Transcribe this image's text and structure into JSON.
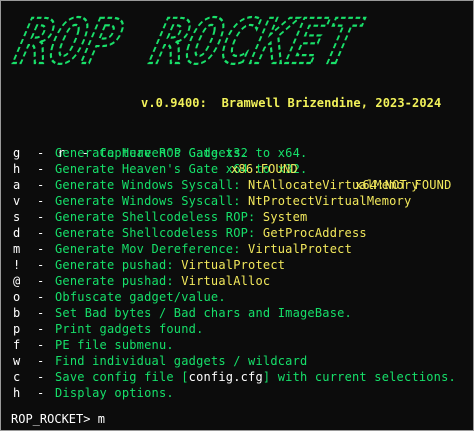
{
  "banner": {
    "text": "ROP ROCKET"
  },
  "version": {
    "text": "v.0.9400:  Bramwell Brizendine, 2023-2024"
  },
  "capture": {
    "x86_label": "x86:",
    "x86_status": "FOUND",
    "x64_label": "x64:",
    "x64_status": "NOT FOUND"
  },
  "menu": [
    {
      "key": "r",
      "label": "Capture ROP Gadgets.",
      "value": ""
    },
    {
      "key": "g",
      "label": "Generate Heaven's Gate x32 to x64.",
      "value": ""
    },
    {
      "key": "h",
      "label": "Generate Heaven's Gate x64 to x32.",
      "value": ""
    },
    {
      "key": "a",
      "label": "Generate Windows Syscall: ",
      "value": "NtAllocateVirtualMemory"
    },
    {
      "key": "v",
      "label": "Generate Windows Syscall: ",
      "value": "NtProtectVirtualMemory"
    },
    {
      "key": "s",
      "label": "Generate Shellcodeless ROP: ",
      "value": "System"
    },
    {
      "key": "d",
      "label": "Generate Shellcodeless ROP: ",
      "value": "GetProcAddress"
    },
    {
      "key": "m",
      "label": "Generate Mov Dereference: ",
      "value": "VirtualProtect"
    },
    {
      "key": "!",
      "label": "Generate pushad: ",
      "value": "VirtualProtect"
    },
    {
      "key": "@",
      "label": "Generate pushad: ",
      "value": "VirtualAlloc"
    },
    {
      "key": "o",
      "label": "Obfuscate gadget/value.",
      "value": ""
    },
    {
      "key": "b",
      "label": "Set Bad bytes / Bad chars and ImageBase.",
      "value": ""
    },
    {
      "key": "p",
      "label": "Print gadgets found.",
      "value": ""
    },
    {
      "key": "f",
      "label": "PE file submenu.",
      "value": ""
    },
    {
      "key": "w",
      "label": "Find individual gadgets / wildcard",
      "value": ""
    },
    {
      "key": "c",
      "label": "Save config file [",
      "value": "config.cfg",
      "suffix": "] with current selections."
    },
    {
      "key": "h",
      "label": "Display options.",
      "value": ""
    }
  ],
  "prompt": {
    "label": "ROP_ROCKET> ",
    "input": "m"
  },
  "colors": {
    "menu_text": "#16e06a",
    "highlight": "#f2e85c",
    "key": "#ffffff",
    "background": "#0c0c0c"
  }
}
